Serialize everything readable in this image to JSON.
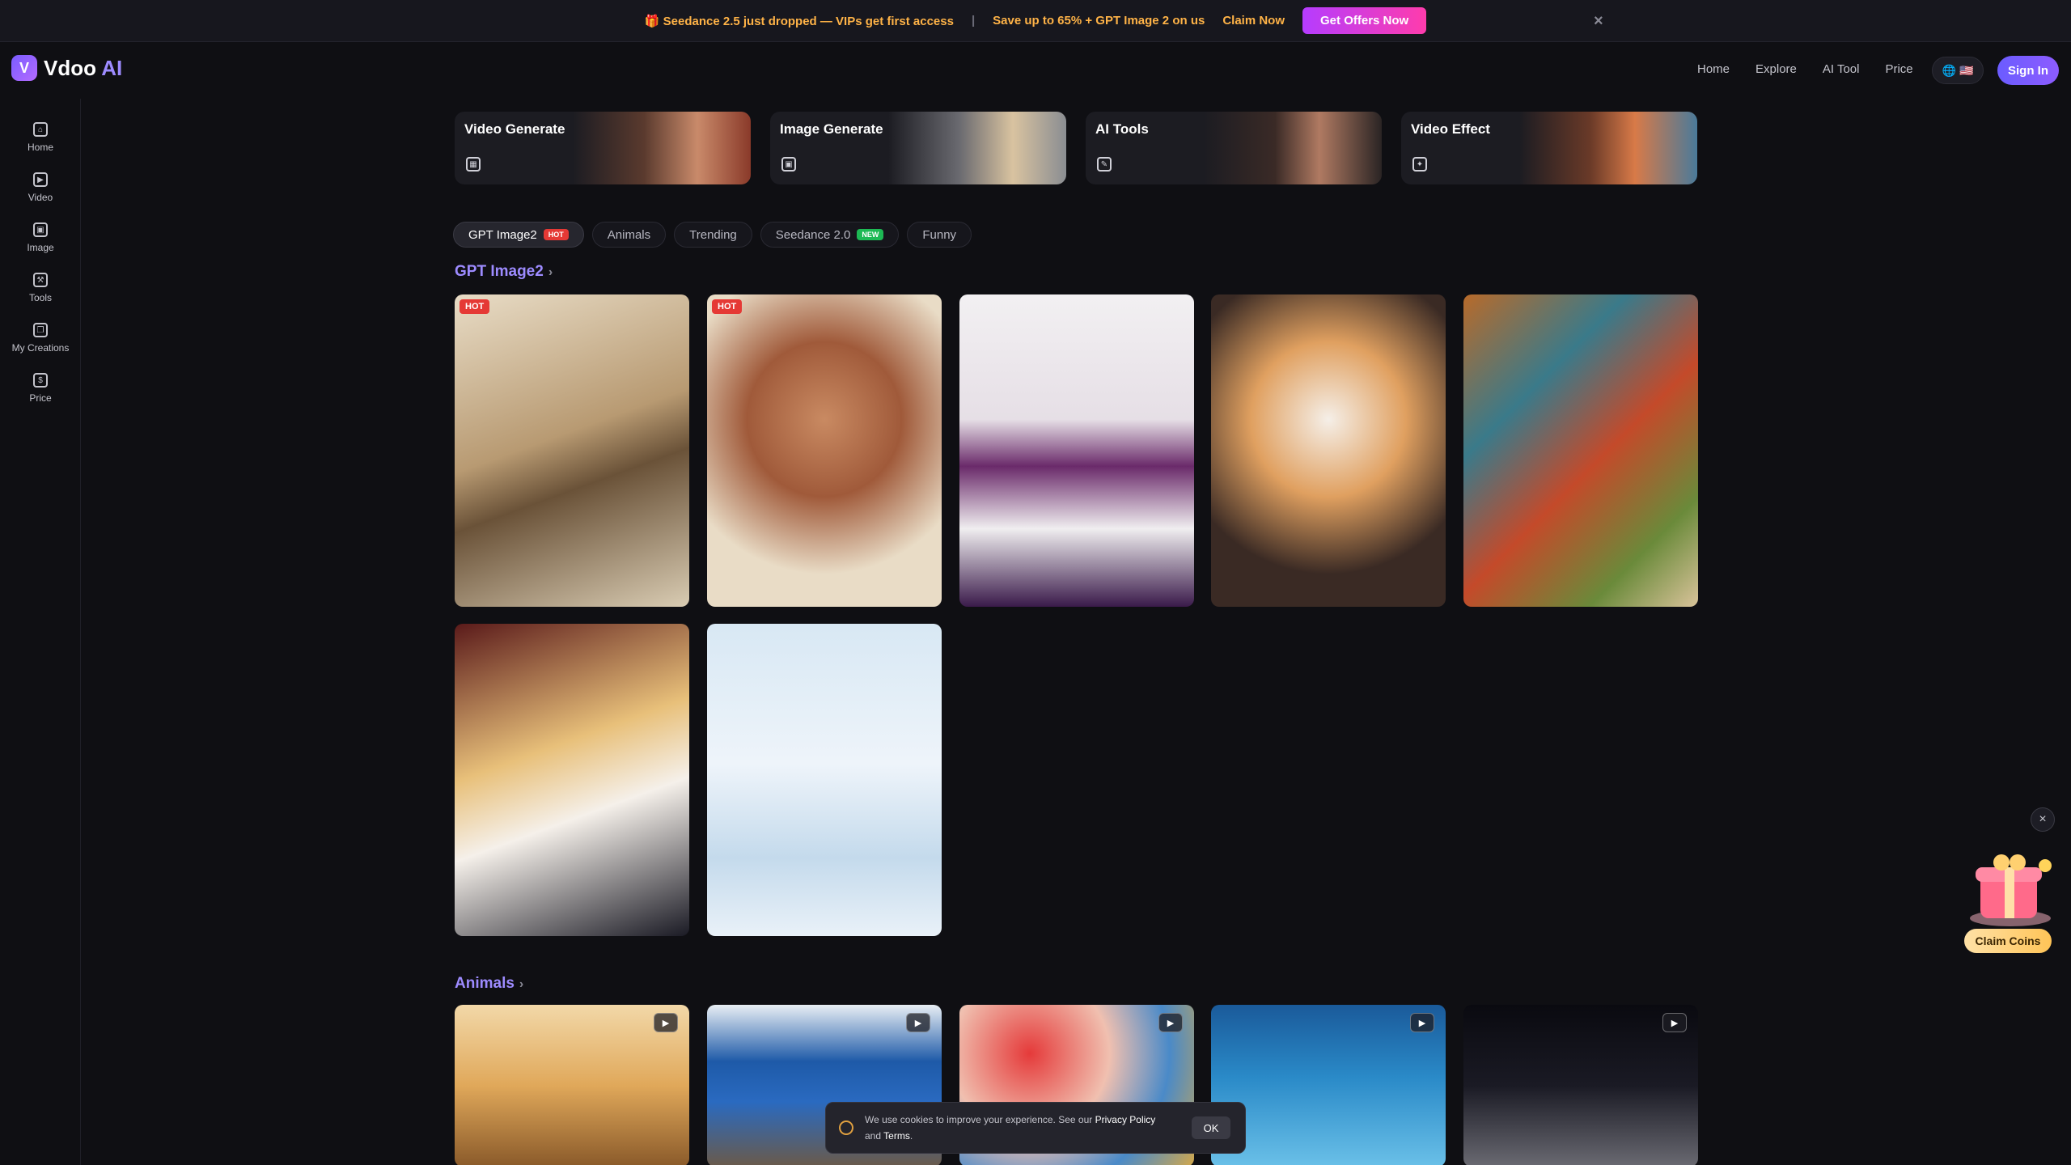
{
  "promo": {
    "text": "🎁 Seedance 2.5 just dropped — VIPs get first access",
    "separator": "|",
    "save_text": "Save up to 65% + GPT Image 2 on us",
    "claim": "Claim Now",
    "offers_button": "Get Offers Now",
    "close": "×"
  },
  "brand": {
    "name": "Vdoo",
    "suffix": "AI",
    "mark": "V"
  },
  "nav": {
    "links": [
      "Home",
      "Explore",
      "AI Tool",
      "Price"
    ],
    "flag": "🇺🇸",
    "sign_in": "Sign In"
  },
  "sidebar": {
    "items": [
      {
        "label": "Home",
        "icon": "⌂"
      },
      {
        "label": "Video",
        "icon": "▶"
      },
      {
        "label": "Image",
        "icon": "▣"
      },
      {
        "label": "Tools",
        "icon": "⚒"
      },
      {
        "label": "My Creations",
        "icon": "❐"
      },
      {
        "label": "Price",
        "icon": "$"
      }
    ]
  },
  "categories": [
    {
      "title": "Video Generate",
      "icon": "▦"
    },
    {
      "title": "Image Generate",
      "icon": "▣"
    },
    {
      "title": "AI Tools",
      "icon": "✎"
    },
    {
      "title": "Video Effect",
      "icon": "✦"
    }
  ],
  "tabs": [
    {
      "label": "GPT Image2",
      "badge": "HOT"
    },
    {
      "label": "Animals",
      "badge": ""
    },
    {
      "label": "Trending",
      "badge": ""
    },
    {
      "label": "Seedance 2.0",
      "badge": "NEW"
    },
    {
      "label": "Funny",
      "badge": ""
    }
  ],
  "sections": {
    "gpt": "GPT Image2",
    "animals": "Animals",
    "chevron": "›"
  },
  "gallery": {
    "hot_badge": "HOT",
    "play_icon": "▶"
  },
  "coins": {
    "label": "Claim Coins",
    "close": "×"
  },
  "cookie": {
    "text": "We use cookies to improve your experience. See our",
    "privacy": "Privacy Policy",
    "and": "and",
    "terms": "Terms",
    "period": ".",
    "ok": "OK"
  }
}
